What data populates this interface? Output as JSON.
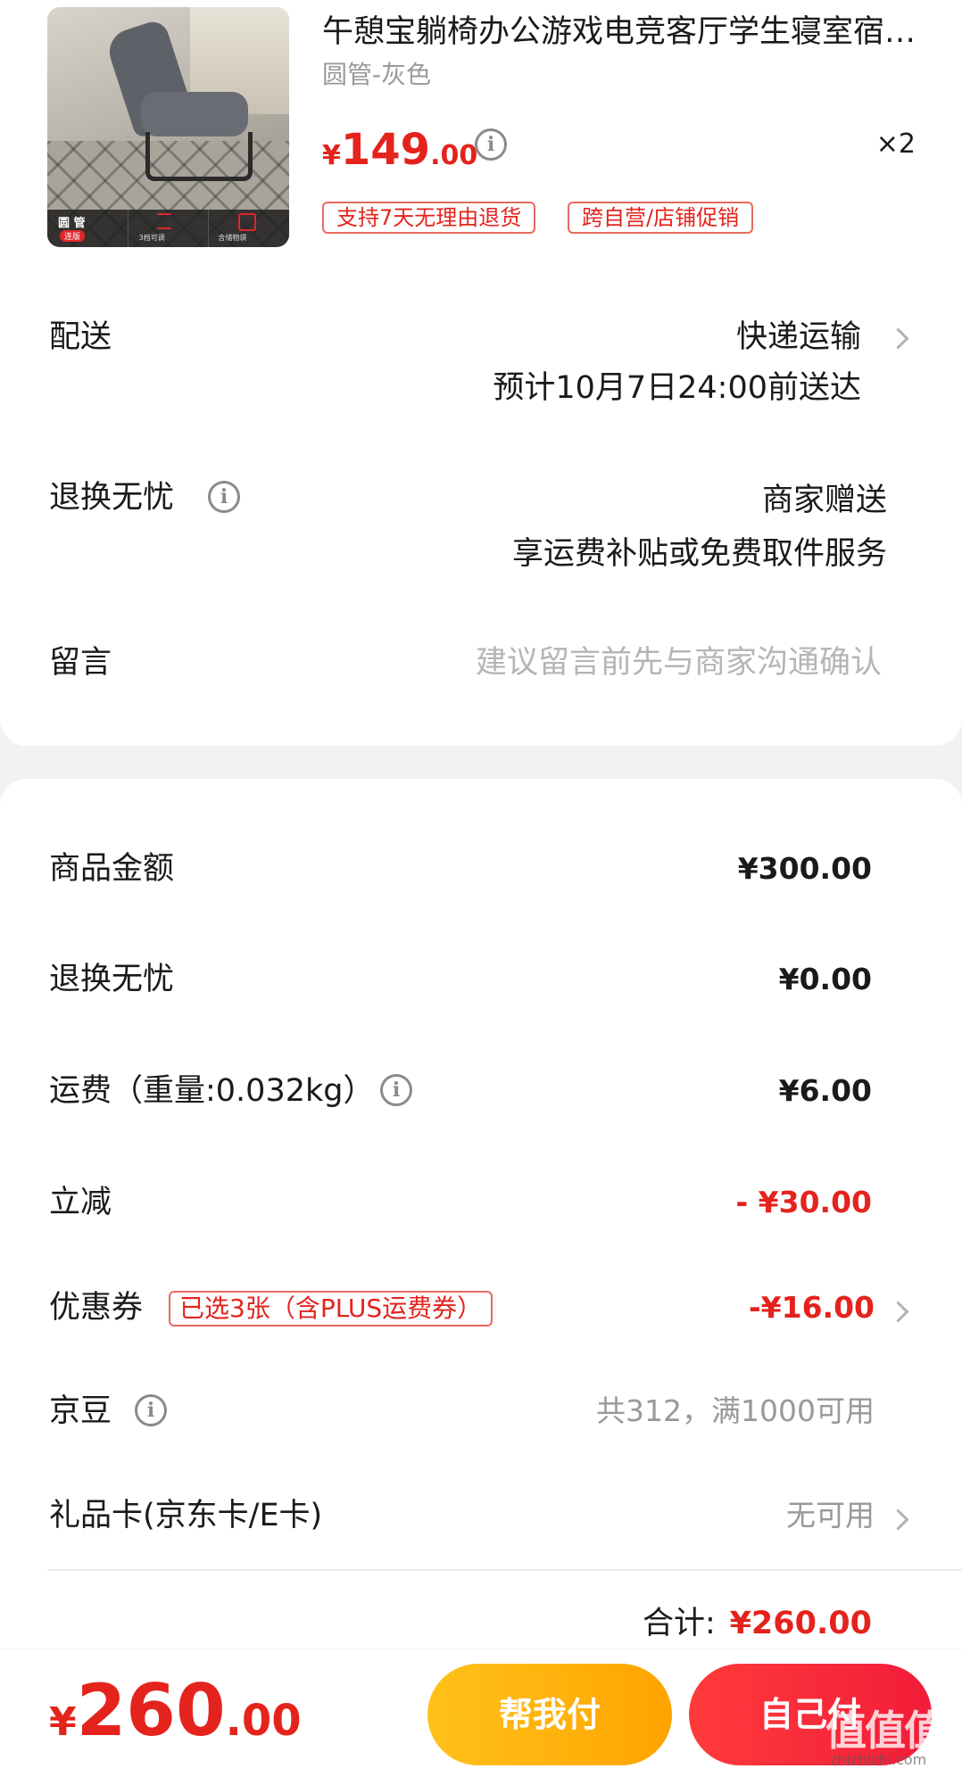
{
  "product": {
    "title": "午憩宝躺椅办公游戏电竞客厅学生寝室宿舍靠背椅",
    "spec": "圆管-灰色",
    "price_symbol": "¥",
    "price_int": "149",
    "price_dec": ".00",
    "quantity": "×2",
    "tags": [
      "支持7天无理由退货",
      "跨自营/店铺促销"
    ],
    "thumb_labels": {
      "round_tube": "圆 管",
      "upgrade": "连版",
      "adjustable": "3档可调",
      "storage": "含储物袋"
    }
  },
  "delivery": {
    "label": "配送",
    "method": "快递运输",
    "estimate": "预计10月7日24:00前送达"
  },
  "return_service": {
    "label": "退换无忧",
    "value": "商家赠送",
    "detail": "享运费补贴或免费取件服务"
  },
  "message": {
    "label": "留言",
    "placeholder": "建议留言前先与商家沟通确认"
  },
  "summary": {
    "goods_label": "商品金额",
    "goods_value": "¥300.00",
    "return_label": "退换无忧",
    "return_value": "¥0.00",
    "shipping_label": "运费（重量:0.032kg）",
    "shipping_value": "¥6.00",
    "discount_label": "立减",
    "discount_value": "- ¥30.00",
    "coupon_label": "优惠券",
    "coupon_tag": "已选3张（含PLUS运费券）",
    "coupon_value": "-¥16.00",
    "jingdou_label": "京豆",
    "jingdou_value": "共312，满1000可用",
    "giftcard_label": "礼品卡(京东卡/E卡)",
    "giftcard_value": "无可用",
    "total_label": "合计:",
    "total_value": "¥260.00"
  },
  "footer": {
    "price_symbol": "¥",
    "price_int": "260",
    "price_dec": ".00",
    "help_pay_label": "帮我付",
    "self_pay_label": "自己付",
    "watermark": "值值值",
    "watermark_site": "zhizhizhi.com"
  },
  "colors": {
    "accent_red": "#e4231d",
    "help_btn": "#ffb000",
    "self_btn": "#f5263a"
  }
}
